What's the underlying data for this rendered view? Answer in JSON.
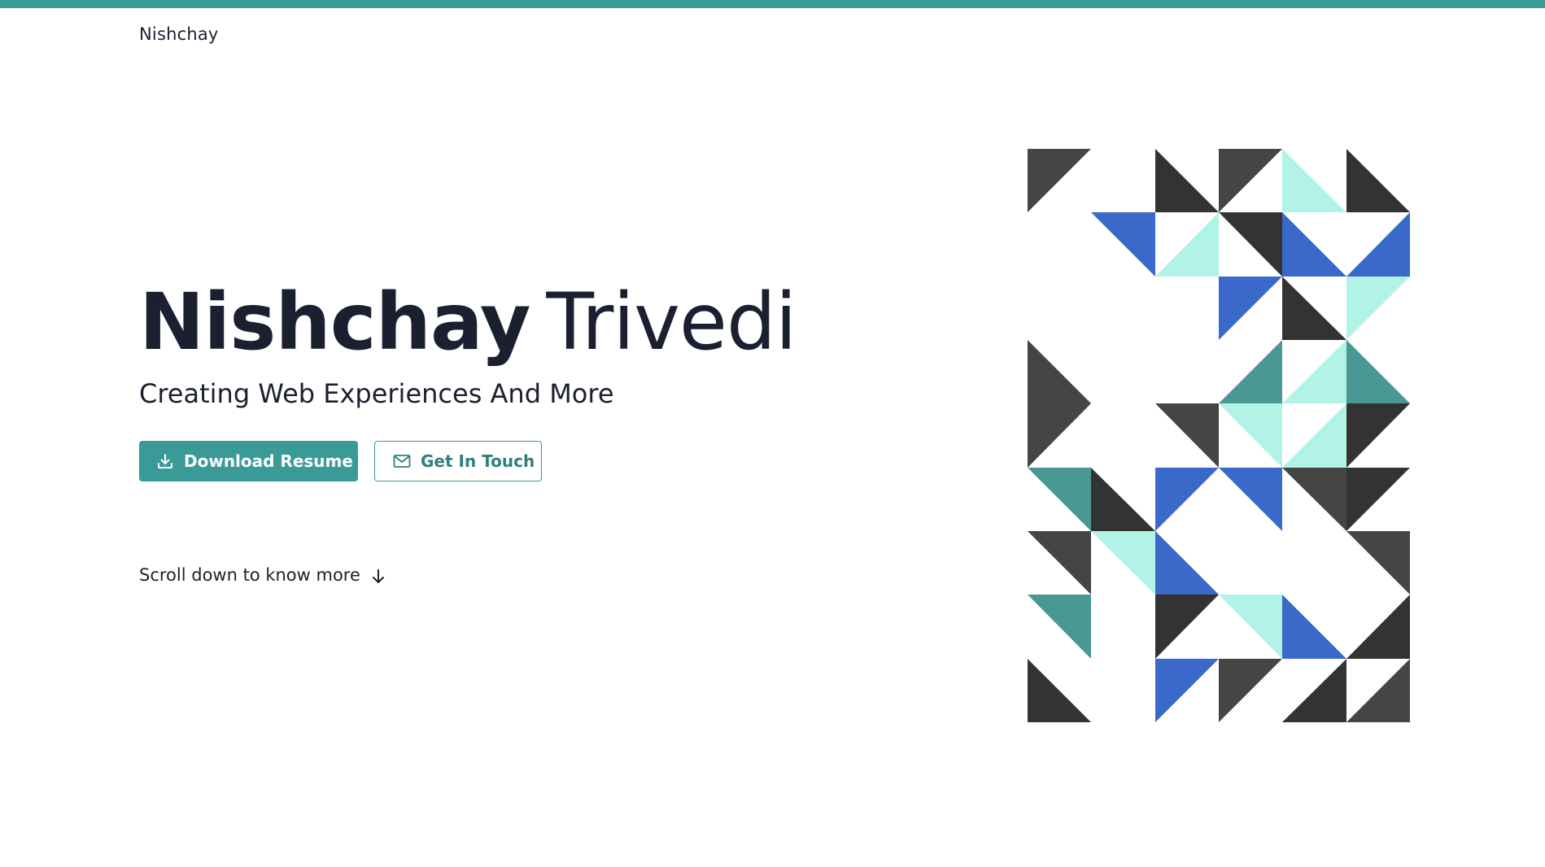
{
  "header": {
    "brand": "Nishchay"
  },
  "hero": {
    "first_name": "Nishchay",
    "last_name": "Trivedi",
    "subtitle": "Creating Web Experiences And More",
    "buttons": {
      "download_label": "Download Resume",
      "contact_label": "Get In Touch"
    },
    "scroll_hint": "Scroll down to know more"
  },
  "icons": {
    "download": "download-icon",
    "contact": "mail-icon",
    "scroll": "arrow-down-icon"
  },
  "colors": {
    "accent": "#3a9a98",
    "text": "#1b2030",
    "pattern": {
      "dark": "#454545",
      "darker": "#333333",
      "blue": "#3b69c9",
      "mint": "#b2f3e7",
      "teal": "#4a9894"
    }
  }
}
